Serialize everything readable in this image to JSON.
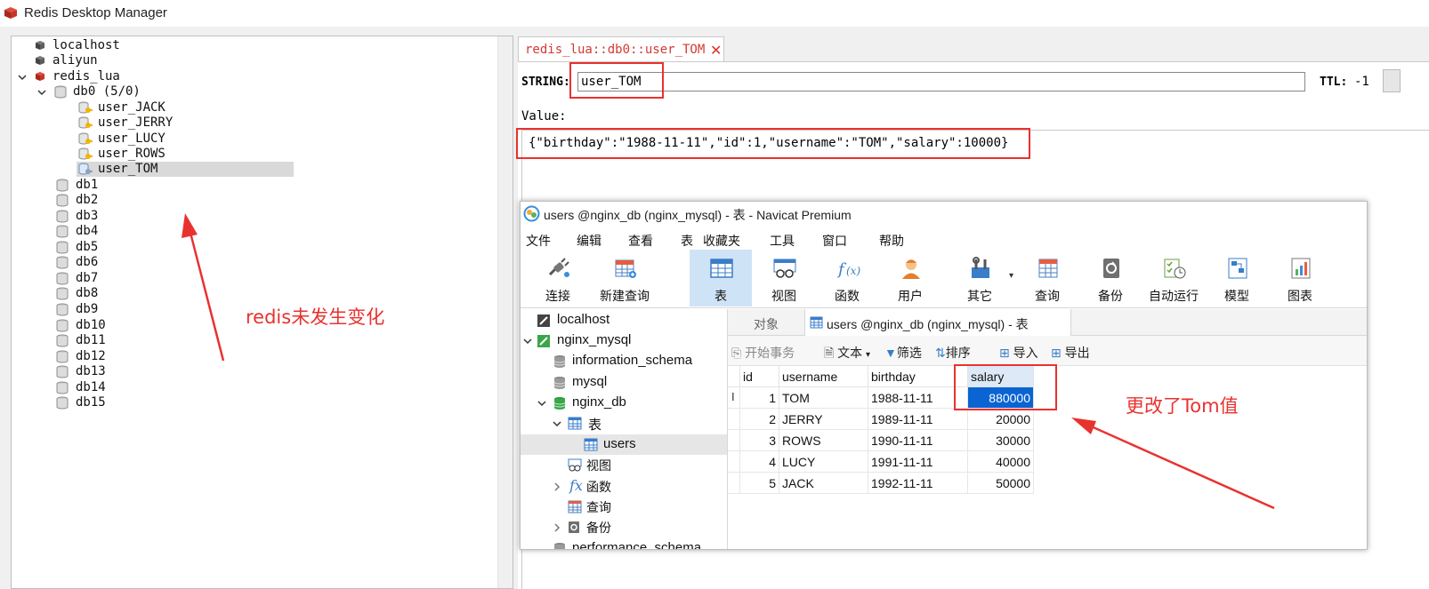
{
  "app": {
    "title": "Redis Desktop Manager"
  },
  "tree": {
    "servers": [
      {
        "label": "localhost"
      },
      {
        "label": "aliyun"
      },
      {
        "label": "redis_lua"
      }
    ],
    "db0_label": "db0 (5/0)",
    "keys": [
      "user_JACK",
      "user_JERRY",
      "user_LUCY",
      "user_ROWS",
      "user_TOM"
    ],
    "databases": [
      "db1",
      "db2",
      "db3",
      "db4",
      "db5",
      "db6",
      "db7",
      "db8",
      "db9",
      "db10",
      "db11",
      "db12",
      "db13",
      "db14",
      "db15"
    ]
  },
  "editor": {
    "tab_label": "redis_lua::db0::user_TOM",
    "type_label": "STRING:",
    "key_value": "user_TOM",
    "ttl_label": "TTL:",
    "ttl_value": "-1",
    "value_label": "Value:",
    "value_text": "{\"birthday\":\"1988-11-11\",\"id\":1,\"username\":\"TOM\",\"salary\":10000}"
  },
  "navicat": {
    "title": "users @nginx_db (nginx_mysql) - 表 - Navicat Premium",
    "menu": [
      "文件",
      "编辑",
      "查看",
      "表",
      "收藏夹",
      "工具",
      "窗口",
      "帮助"
    ],
    "toolbar": [
      "连接",
      "新建查询",
      "表",
      "视图",
      "函数",
      "用户",
      "其它",
      "查询",
      "备份",
      "自动运行",
      "模型",
      "图表"
    ],
    "tree": {
      "localhost": "localhost",
      "connection": "nginx_mysql",
      "information_schema": "information_schema",
      "mysql": "mysql",
      "nginx_db": "nginx_db",
      "tables_folder": "表",
      "users_table": "users",
      "views_folder": "视图",
      "functions_folder": "函数",
      "queries_folder": "查询",
      "backups_folder": "备份",
      "performance_schema": "performance_schema"
    },
    "tabs": {
      "objects": "对象",
      "users": "users @nginx_db (nginx_mysql) - 表"
    },
    "subtoolbar": {
      "begin_tx": "开始事务",
      "text": "文本",
      "filter": "筛选",
      "sort": "排序",
      "import": "导入",
      "export": "导出"
    },
    "table": {
      "columns": [
        "id",
        "username",
        "birthday",
        "salary"
      ],
      "rows": [
        {
          "id": "1",
          "username": "TOM",
          "birthday": "1988-11-11",
          "salary": "880000"
        },
        {
          "id": "2",
          "username": "JERRY",
          "birthday": "1989-11-11",
          "salary": "20000"
        },
        {
          "id": "3",
          "username": "ROWS",
          "birthday": "1990-11-11",
          "salary": "30000"
        },
        {
          "id": "4",
          "username": "LUCY",
          "birthday": "1991-11-11",
          "salary": "40000"
        },
        {
          "id": "5",
          "username": "JACK",
          "birthday": "1992-11-11",
          "salary": "50000"
        }
      ],
      "cursor_marker": "I"
    }
  },
  "annotations": {
    "left_note": "redis未发生变化",
    "right_note": "更改了Tom值"
  },
  "colors": {
    "annotation_red": "#e8322f",
    "selection_blue": "#0a64d2",
    "tab_red": "#d23a33"
  }
}
